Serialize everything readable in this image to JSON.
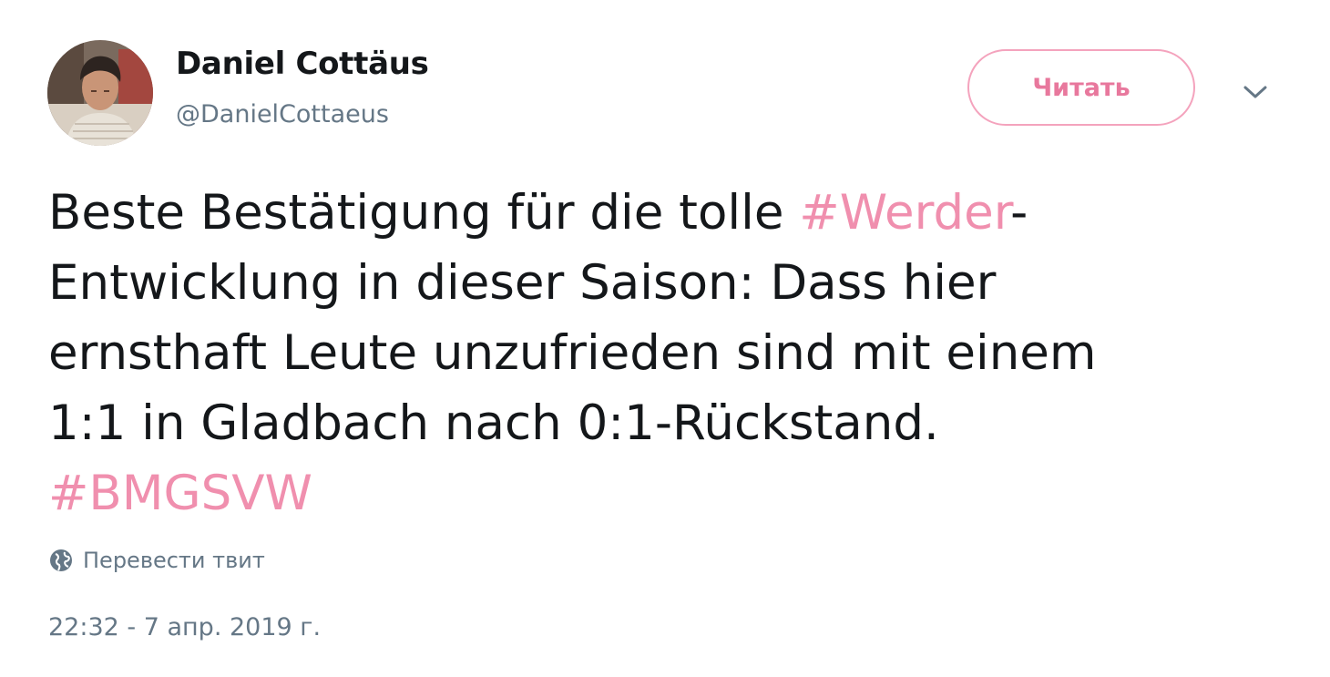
{
  "author": {
    "name": "Daniel Cottäus",
    "handle": "@DanielCottaeus"
  },
  "follow_button": {
    "label": "Читать"
  },
  "menu": {
    "icon": "chevron-down-icon"
  },
  "tweet": {
    "line1_text": "Beste Bestätigung für die tolle ",
    "hashtag1": "#Werder",
    "line1_suffix": "-",
    "line2": "Entwicklung in dieser Saison: Dass hier",
    "line3": "ernsthaft Leute unzufrieden sind mit einem",
    "line4": "1:1 in Gladbach nach 0:1-Rückstand.",
    "hashtag2": "#BMGSVW"
  },
  "translate": {
    "icon": "globe-icon",
    "label": "Перевести твит"
  },
  "timestamp": "22:32 - 7 апр. 2019 г.",
  "colors": {
    "accent": "#f08fae",
    "button_border": "#f4a3bd",
    "text": "#14171a",
    "secondary": "#657786"
  }
}
